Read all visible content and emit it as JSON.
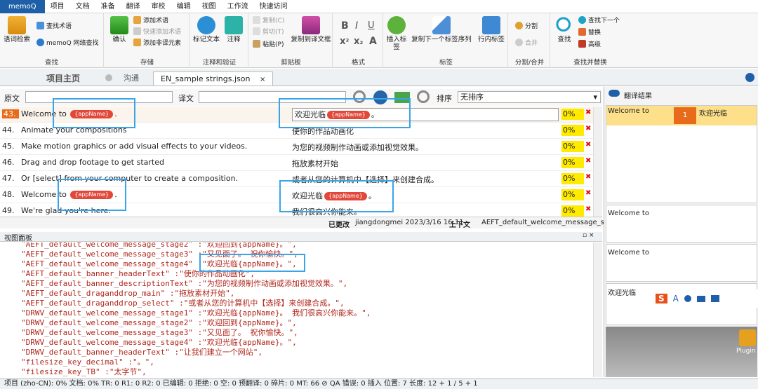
{
  "menubar": {
    "brand": "memoQ",
    "items": [
      "项目",
      "文档",
      "准备",
      "翻译",
      "审校",
      "编辑",
      "视图",
      "工作流",
      "快速访问"
    ]
  },
  "ribbon": {
    "lookup": {
      "btn_big": "语词检索",
      "btn_find_term": "查找术语",
      "btn_web_search": "memoQ 网络查找",
      "label": "查找"
    },
    "store": {
      "btn_confirm": "确认",
      "btn_add_term": "添加术语",
      "btn_quick_add": "快速添加术语",
      "btn_add_forbidden": "添加非译元素",
      "label": "存储"
    },
    "comment": {
      "btn_mark": "标记文本",
      "btn_comment": "注释",
      "label": "注释和验证"
    },
    "clipboard": {
      "btn_copy": "复制(C)",
      "btn_cut": "剪切(T)",
      "btn_paste": "粘贴(P)",
      "btn_copy_src": "复制到译文框",
      "label": "剪贴板"
    },
    "format": {
      "b": "B",
      "i": "I",
      "u": "U",
      "sup": "X²",
      "sub": "X₂",
      "a": "A",
      "label": "格式"
    },
    "tags": {
      "btn_insert": "插入标签",
      "btn_copy_next": "复制下一个标签序列",
      "btn_inline": "行内标签",
      "label": "标签"
    },
    "split": {
      "btn_split": "分割",
      "btn_join": "合并",
      "label": "分割/合并"
    },
    "find": {
      "btn_find": "查找",
      "btn_find_next": "查找下一个",
      "btn_replace": "替换",
      "btn_advanced": "高级",
      "label": "查找并替换"
    }
  },
  "tabs": {
    "home": "项目主页",
    "comm": "沟通",
    "file": "EN_sample strings.json",
    "close": "×"
  },
  "filter": {
    "source_label": "原文",
    "target_label": "译文",
    "sort_label": "排序",
    "sort_value": "无排序"
  },
  "rows": [
    {
      "num": "43.",
      "src_pre": "Welcome to ",
      "src_tag": "{appName}",
      "src_post": ".",
      "tgt_pre": "欢迎光临",
      "tgt_tag": "{appName}",
      "tgt_post": "。",
      "pct": "0%"
    },
    {
      "num": "44.",
      "src_pre": "Animate your compositions",
      "src_tag": "",
      "src_post": "",
      "tgt_pre": "使你的作品动画化",
      "tgt_tag": "",
      "tgt_post": "",
      "pct": "0%"
    },
    {
      "num": "45.",
      "src_pre": "Make motion graphics or add visual effects to your videos.",
      "src_tag": "",
      "src_post": "",
      "tgt_pre": "为您的视频制作动画或添加视觉效果。",
      "tgt_tag": "",
      "tgt_post": "",
      "pct": "0%"
    },
    {
      "num": "46.",
      "src_pre": "Drag and drop footage to get started",
      "src_tag": "",
      "src_post": "",
      "tgt_pre": "拖放素材开始",
      "tgt_tag": "",
      "tgt_post": "",
      "pct": "0%"
    },
    {
      "num": "47.",
      "src_pre": "Or [select] from your computer to create a composition.",
      "src_tag": "",
      "src_post": "",
      "tgt_pre": "或者从您的计算机中【选择】来创建合成。",
      "tgt_tag": "",
      "tgt_post": "",
      "pct": "0%"
    },
    {
      "num": "48.",
      "src_pre": "Welcome to ",
      "src_tag": "{appName}",
      "src_post": ".",
      "tgt_pre": "欢迎光临",
      "tgt_tag": "{appName}",
      "tgt_post": "。",
      "pct": "0%"
    },
    {
      "num": "49.",
      "src_pre": "We're glad you're here.",
      "src_tag": "",
      "src_post": "",
      "tgt_pre": "我们很高兴你能来。",
      "tgt_tag": "",
      "tgt_post": "",
      "pct": "0%"
    }
  ],
  "rowstatus": {
    "changed": "已更改",
    "user": "jiangdongmei 2023/3/16 16:11",
    "context_label": "上下文",
    "context": "AEFT_default_welcome_message_stage4"
  },
  "viewpane": {
    "title": "视图面板",
    "lines": [
      {
        "k": "\"AEFT_default_welcome_message_stage2\"",
        "v": " :\"欢迎回到{appName}。\","
      },
      {
        "k": "\"AEFT_default_welcome_message_stage3\"",
        "v": " :\"又见面了。 祝你愉快。\","
      },
      {
        "k": "\"AEFT_default_welcome_message_stage4\"",
        "v": " :\"欢迎光临{appName}。\","
      },
      {
        "k": "\"AEFT_default_banner_headerText\"",
        "v": " :\"使你的作品动画化\","
      },
      {
        "k": "\"AEFT_default_banner_descriptionText\"",
        "v": " :\"为您的视频制作动画或添加视觉效果。\","
      },
      {
        "k": "\"AEFT_default_draganddrop_main\"",
        "v": " :\"拖放素材开始\","
      },
      {
        "k": "\"AEFT_default_draganddrop_select\"",
        "v": " :\"或者从您的计算机中【选择】来创建合成。\","
      },
      {
        "k": "\"DRWV_default_welcome_message_stage1\"",
        "v": " :\"欢迎光临{appName}。 我们很高兴你能来。\","
      },
      {
        "k": "\"DRWV_default_welcome_message_stage2\"",
        "v": " :\"欢迎回到{appName}。\","
      },
      {
        "k": "\"DRWV_default_welcome_message_stage3\"",
        "v": " :\"又见面了。 祝你愉快。\","
      },
      {
        "k": "\"DRWV_default_welcome_message_stage4\"",
        "v": " :\"欢迎光临{appName}。\","
      },
      {
        "k": "\"DRWV_default_banner_headerText\"",
        "v": " :\"让我们建立一个网站\","
      },
      {
        "k": "\"filesize_key_decimal\"",
        "v": " :\"。\","
      },
      {
        "k": "\"filesize_key_TB\"",
        "v": " :\"太字节\","
      }
    ]
  },
  "right": {
    "title": "翻译结果",
    "result_src": "Welcome to",
    "result_tgt": "欢迎光临",
    "result_num": "1",
    "panel2": "Welcome to",
    "panel3": "Welcome to",
    "panel4": "欢迎光临",
    "ime_s": "S",
    "ime_a": "A",
    "plugin": "Plugin"
  },
  "status": "项目 (zho-CN): 0%  文档: 0%  TR: 0   R1: 0   R2: 0   已编辑: 0   拒绝: 0   空: 0   预翻译: 0   碎片: 0   MT: 66  ⊘ QA 错误: 0   插入   位置: 7  长度: 12 + 1 / 5 + 1"
}
